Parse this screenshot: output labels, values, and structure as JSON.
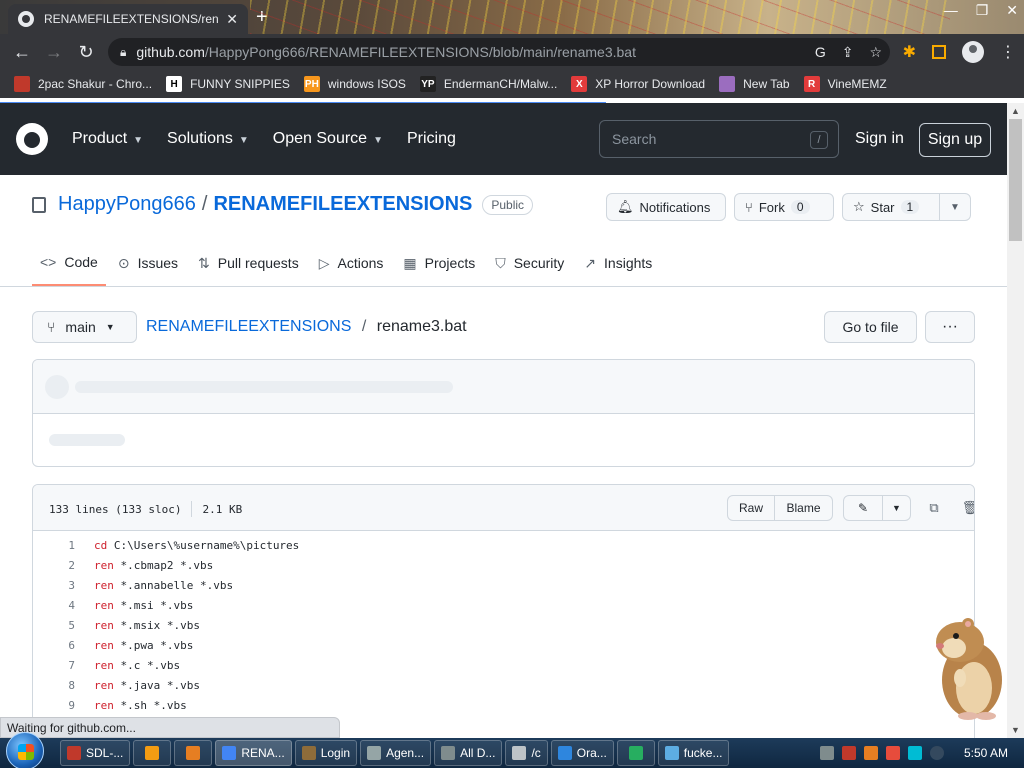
{
  "browser": {
    "tab_title": "RENAMEFILEEXTENSIONS/renam",
    "url_host": "github.com",
    "url_path": "/HappyPong666/RENAMEFILEEXTENSIONS/blob/main/rename3.bat",
    "status_text": "Waiting for github.com...",
    "bookmarks": [
      {
        "label": "2pac Shakur - Chro...",
        "icon": "bookmark-icon",
        "color": "#c0392b"
      },
      {
        "label": "FUNNY SNIPPIES",
        "icon": "H",
        "color": "#ffffff"
      },
      {
        "label": "windows ISOS",
        "icon": "PH",
        "color": "#f7971d"
      },
      {
        "label": "EndermanCH/Malw...",
        "icon": "YP",
        "color": "#222222"
      },
      {
        "label": "XP Horror Download",
        "icon": "X",
        "color": "#e23b3b"
      },
      {
        "label": "New Tab",
        "icon": "globe-icon",
        "color": "#9b6dbf"
      },
      {
        "label": "VineMEMZ",
        "icon": "R",
        "color": "#e23b3b"
      }
    ]
  },
  "github": {
    "nav": [
      "Product",
      "Solutions",
      "Open Source",
      "Pricing"
    ],
    "search_placeholder": "Search",
    "search_key": "/",
    "sign_in": "Sign in",
    "sign_up": "Sign up"
  },
  "repo": {
    "owner": "HappyPong666",
    "separator": "/",
    "name": "RENAMEFILEEXTENSIONS",
    "visibility": "Public",
    "notifications_label": "Notifications",
    "fork_label": "Fork",
    "fork_count": "0",
    "star_label": "Star",
    "star_count": "1",
    "tabs": [
      "Code",
      "Issues",
      "Pull requests",
      "Actions",
      "Projects",
      "Security",
      "Insights"
    ],
    "branch": "main",
    "crumb_repo": "RENAMEFILEEXTENSIONS",
    "crumb_sep": "/",
    "file_name": "rename3.bat",
    "go_to_file": "Go to file",
    "more_label": "···"
  },
  "file": {
    "lines_info": "133 lines (133 sloc)",
    "size": "2.1 KB",
    "raw_label": "Raw",
    "blame_label": "Blame",
    "code": [
      {
        "n": "1",
        "kw": "cd",
        "rest": " C:\\Users\\%username%\\pictures"
      },
      {
        "n": "2",
        "kw": "ren",
        "rest": " *.cbmap2 *.vbs"
      },
      {
        "n": "3",
        "kw": "ren",
        "rest": " *.annabelle *.vbs"
      },
      {
        "n": "4",
        "kw": "ren",
        "rest": " *.msi *.vbs"
      },
      {
        "n": "5",
        "kw": "ren",
        "rest": " *.msix *.vbs"
      },
      {
        "n": "6",
        "kw": "ren",
        "rest": " *.pwa *.vbs"
      },
      {
        "n": "7",
        "kw": "ren",
        "rest": " *.c *.vbs"
      },
      {
        "n": "8",
        "kw": "ren",
        "rest": " *.java *.vbs"
      },
      {
        "n": "9",
        "kw": "ren",
        "rest": " *.sh *.vbs"
      }
    ]
  },
  "taskbar": {
    "items": [
      {
        "label": "SDL-...",
        "color": "#c0392b"
      },
      {
        "label": "",
        "color": "#f39c12"
      },
      {
        "label": "",
        "color": "#e67e22"
      },
      {
        "label": "RENA...",
        "color": "#4285f4",
        "active": true
      },
      {
        "label": "Login",
        "color": "#8e6c3a"
      },
      {
        "label": "Agen...",
        "color": "#95a5a6"
      },
      {
        "label": "All D...",
        "color": "#7f8c8d"
      },
      {
        "label": "/c",
        "color": "#bdc3c7"
      },
      {
        "label": "Ora...",
        "color": "#2e86de"
      },
      {
        "label": "",
        "color": "#27ae60"
      },
      {
        "label": "fucke...",
        "color": "#5dade2"
      }
    ],
    "clock": "5:50 AM"
  }
}
